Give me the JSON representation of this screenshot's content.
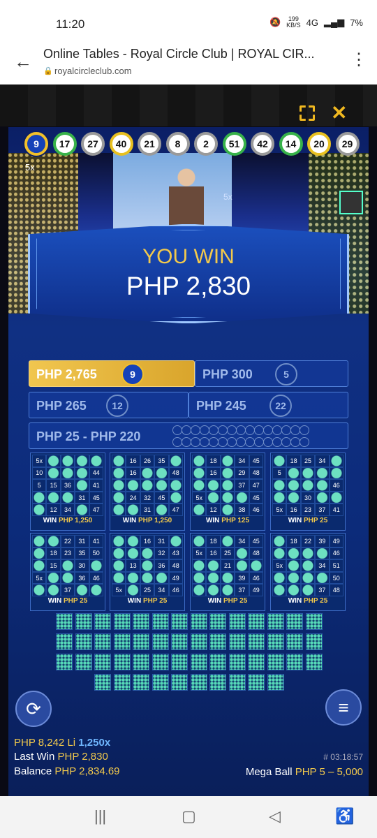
{
  "status": {
    "time": "11:20",
    "speed": "199",
    "speed_unit": "KB/S",
    "network": "4G",
    "battery": "7%"
  },
  "browser": {
    "title": "Online Tables - Royal Circle Club | ROYAL CIR...",
    "url": "royalcircleclub.com"
  },
  "balls": [
    {
      "n": "9",
      "type": "mega"
    },
    {
      "n": "17",
      "type": "green"
    },
    {
      "n": "27",
      "type": "gray"
    },
    {
      "n": "40",
      "type": "yellow"
    },
    {
      "n": "21",
      "type": "gray"
    },
    {
      "n": "8",
      "type": "gray"
    },
    {
      "n": "2",
      "type": "gray"
    },
    {
      "n": "51",
      "type": "green"
    },
    {
      "n": "42",
      "type": "gray"
    },
    {
      "n": "14",
      "type": "green"
    },
    {
      "n": "20",
      "type": "yellow"
    },
    {
      "n": "29",
      "type": "gray"
    }
  ],
  "mega_multiplier": "5x",
  "scene_multiplier": "5x",
  "win": {
    "title": "YOU WIN",
    "amount": "PHP 2,830"
  },
  "prizes": [
    {
      "label": "PHP 2,765",
      "num": "9",
      "active": true
    },
    {
      "label": "PHP 300",
      "num": "5",
      "active": false
    },
    {
      "label": "PHP 265",
      "num": "12",
      "active": false
    },
    {
      "label": "PHP 245",
      "num": "22",
      "active": false
    },
    {
      "label": "PHP 25 - PHP 220",
      "num": "",
      "active": false
    }
  ],
  "cards": [
    {
      "win": "PHP 1,250",
      "cells": [
        "5x",
        "",
        "",
        "",
        "",
        "10",
        "",
        "",
        "",
        "44",
        "5",
        "15",
        "36",
        "",
        "41",
        "",
        "",
        "",
        "31",
        "45",
        "",
        "12",
        "34",
        "",
        "47"
      ]
    },
    {
      "win": "PHP 1,250",
      "cells": [
        "",
        "16",
        "26",
        "35",
        "",
        "",
        "16",
        "",
        "",
        "48",
        "",
        "",
        "",
        "",
        "",
        "",
        "24",
        "32",
        "45",
        "",
        "",
        "",
        "31",
        "",
        "47"
      ]
    },
    {
      "win": "PHP 125",
      "cells": [
        "",
        "18",
        "",
        "34",
        "45",
        "",
        "16",
        "",
        "29",
        "48",
        "",
        "",
        "",
        "37",
        "47",
        "5x",
        "",
        "",
        "",
        "45",
        "",
        "12",
        "",
        "38",
        "46"
      ]
    },
    {
      "win": "PHP 25",
      "cells": [
        "",
        "18",
        "25",
        "34",
        "",
        "5",
        "",
        "",
        "",
        "",
        "",
        "",
        "",
        "",
        "46",
        "",
        "",
        "30",
        "",
        "",
        "5x",
        "16",
        "23",
        "37",
        "41"
      ]
    },
    {
      "win": "PHP 25",
      "cells": [
        "",
        "",
        "22",
        "31",
        "41",
        "",
        "18",
        "23",
        "35",
        "50",
        "",
        "15",
        "",
        "30",
        "",
        "5x",
        "",
        "",
        "36",
        "46",
        "",
        "",
        "37",
        "",
        ""
      ]
    },
    {
      "win": "PHP 25",
      "cells": [
        "",
        "",
        "16",
        "31",
        "",
        "",
        "",
        "",
        "32",
        "43",
        "",
        "13",
        "",
        "36",
        "48",
        "",
        "",
        "",
        "",
        "49",
        "5x",
        "",
        "25",
        "34",
        "46"
      ]
    },
    {
      "win": "PHP 25",
      "cells": [
        "",
        "18",
        "",
        "34",
        "45",
        "5x",
        "16",
        "25",
        "",
        "48",
        "",
        "",
        "21",
        "",
        "",
        "",
        "",
        "",
        "39",
        "46",
        "",
        "",
        "",
        "37",
        "49"
      ]
    },
    {
      "win": "PHP 25",
      "cells": [
        "",
        "18",
        "22",
        "39",
        "49",
        "",
        "",
        "",
        "",
        "46",
        "5x",
        "",
        "",
        "34",
        "51",
        "",
        "",
        "",
        "",
        "50",
        "",
        "",
        "",
        "37",
        "48"
      ]
    }
  ],
  "footer": {
    "bet": "PHP 8,242 Li",
    "multiplier": "1,250x",
    "last_win_label": "Last Win",
    "last_win_value": "PHP 2,830",
    "balance_label": "Balance",
    "balance_value": "PHP 2,834.69",
    "game_id": "# 03:18:57",
    "limits_label": "Mega Ball",
    "limits_value": "PHP 5 – 5,000"
  },
  "card_win_prefix": "WIN"
}
